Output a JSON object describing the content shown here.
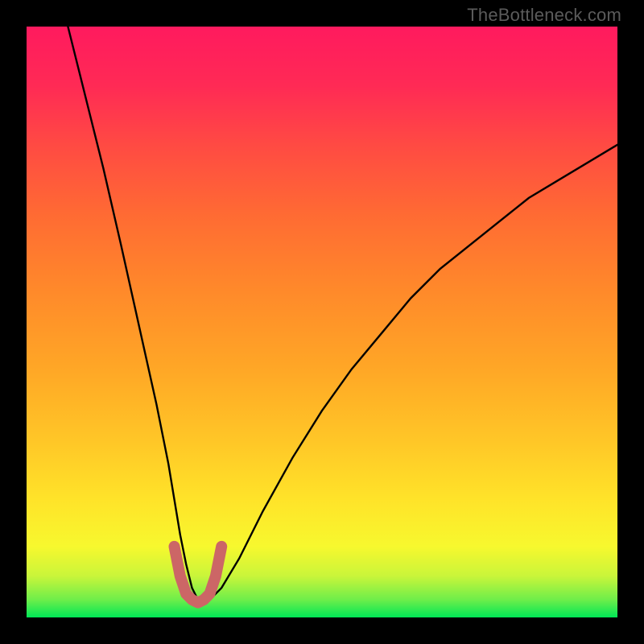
{
  "watermark": "TheBottleneck.com",
  "chart_data": {
    "type": "line",
    "title": "",
    "xlabel": "",
    "ylabel": "",
    "xlim": [
      0,
      100
    ],
    "ylim": [
      0,
      100
    ],
    "grid": false,
    "series": [
      {
        "name": "bottleneck-curve",
        "color": "#000000",
        "x": [
          7,
          10,
          13,
          16,
          18,
          20,
          22,
          24,
          25,
          26,
          27,
          28,
          29,
          30,
          31,
          33,
          36,
          40,
          45,
          50,
          55,
          60,
          65,
          70,
          75,
          80,
          85,
          90,
          95,
          100
        ],
        "y": [
          100,
          88,
          76,
          63,
          54,
          45,
          36,
          26,
          20,
          14,
          9,
          5,
          3,
          2.5,
          3,
          5,
          10,
          18,
          27,
          35,
          42,
          48,
          54,
          59,
          63,
          67,
          71,
          74,
          77,
          80
        ]
      },
      {
        "name": "valley-marker",
        "color": "#cc6666",
        "x": [
          25,
          26,
          27,
          28,
          29,
          30,
          31,
          32,
          33
        ],
        "y": [
          12,
          7,
          4,
          3,
          2.5,
          3,
          4,
          7,
          12
        ]
      }
    ],
    "minimum_at_x": 29,
    "minimum_value": 2.5
  }
}
